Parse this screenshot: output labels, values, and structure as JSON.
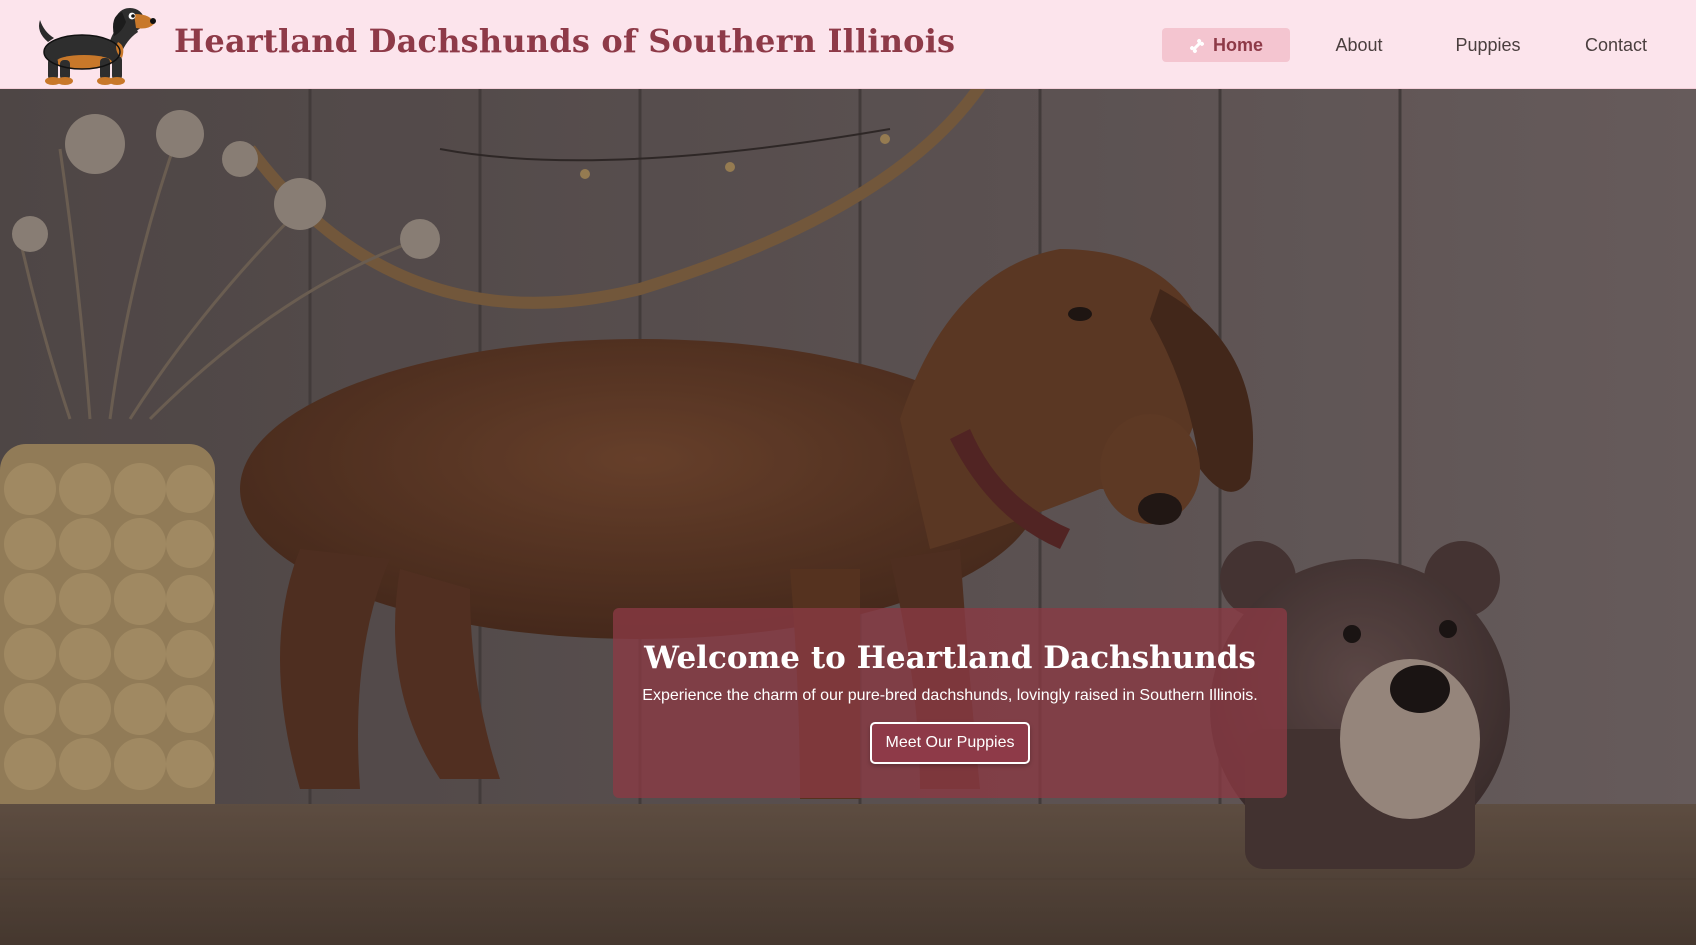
{
  "header": {
    "site_title": "Heartland Dachshunds of Southern Illinois",
    "logo_icon": "dachshund-cartoon-logo",
    "background_color": "#fce4ec",
    "title_color": "#8e3a48"
  },
  "nav": {
    "active_icon": "bone-icon",
    "items": [
      {
        "label": "Home",
        "active": true
      },
      {
        "label": "About",
        "active": false
      },
      {
        "label": "Puppies",
        "active": false
      },
      {
        "label": "Contact",
        "active": false
      }
    ]
  },
  "hero": {
    "title": "Welcome to Heartland Dachshunds",
    "subtitle": "Experience the charm of our pure-bred dachshunds, lovingly raised in Southern Illinois.",
    "cta_label": "Meet Our Puppies",
    "card_color": "#8b3a44"
  }
}
